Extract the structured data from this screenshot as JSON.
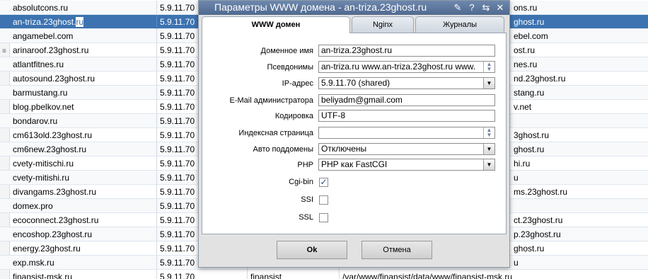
{
  "table": {
    "rows": [
      {
        "name": "absolutcons.ru",
        "ip": "5.9.11.70",
        "owner": "",
        "path": "",
        "right_visible": "ons.ru"
      },
      {
        "name": "an-triza.23ghost.ru",
        "ip": "5.9.11.70",
        "owner": "",
        "path": "",
        "right_visible": "ghost.ru"
      },
      {
        "name": "angamebel.com",
        "ip": "5.9.11.70",
        "owner": "",
        "path": "",
        "right_visible": "ebel.com"
      },
      {
        "name": "arinaroof.23ghost.ru",
        "ip": "5.9.11.70",
        "owner": "",
        "path": "",
        "right_visible": "ost.ru"
      },
      {
        "name": "atlantfitnes.ru",
        "ip": "5.9.11.70",
        "owner": "",
        "path": "",
        "right_visible": "nes.ru"
      },
      {
        "name": "autosound.23ghost.ru",
        "ip": "5.9.11.70",
        "owner": "",
        "path": "",
        "right_visible": "nd.23ghost.ru"
      },
      {
        "name": "barmustang.ru",
        "ip": "5.9.11.70",
        "owner": "",
        "path": "",
        "right_visible": "stang.ru"
      },
      {
        "name": "blog.pbelkov.net",
        "ip": "5.9.11.70",
        "owner": "",
        "path": "",
        "right_visible": "v.net"
      },
      {
        "name": "bondarov.ru",
        "ip": "5.9.11.70",
        "owner": "",
        "path": "",
        "right_visible": ""
      },
      {
        "name": "cm613old.23ghost.ru",
        "ip": "5.9.11.70",
        "owner": "",
        "path": "",
        "right_visible": "3ghost.ru"
      },
      {
        "name": "cm6new.23ghost.ru",
        "ip": "5.9.11.70",
        "owner": "",
        "path": "",
        "right_visible": "ghost.ru"
      },
      {
        "name": "cvety-mitischi.ru",
        "ip": "5.9.11.70",
        "owner": "",
        "path": "",
        "right_visible": "hi.ru"
      },
      {
        "name": "cvety-mitishi.ru",
        "ip": "5.9.11.70",
        "owner": "",
        "path": "",
        "right_visible": "u"
      },
      {
        "name": "divangams.23ghost.ru",
        "ip": "5.9.11.70",
        "owner": "",
        "path": "",
        "right_visible": "ms.23ghost.ru"
      },
      {
        "name": "domex.pro",
        "ip": "5.9.11.70",
        "owner": "",
        "path": "",
        "right_visible": ""
      },
      {
        "name": "ecoconnect.23ghost.ru",
        "ip": "5.9.11.70",
        "owner": "",
        "path": "",
        "right_visible": "ct.23ghost.ru"
      },
      {
        "name": "encoshop.23ghost.ru",
        "ip": "5.9.11.70",
        "owner": "",
        "path": "",
        "right_visible": "p.23ghost.ru"
      },
      {
        "name": "energy.23ghost.ru",
        "ip": "5.9.11.70",
        "owner": "",
        "path": "",
        "right_visible": "ghost.ru"
      },
      {
        "name": "exp.msk.ru",
        "ip": "5.9.11.70",
        "owner": "",
        "path": "",
        "right_visible": "u"
      },
      {
        "name": "finansist-msk.ru",
        "ip": "5.9.11.70",
        "owner": "finansist",
        "path": "/var/www/finansist/data/www/finansist-msk.ru",
        "right_visible": ""
      }
    ],
    "selected_row": 1,
    "selected_name_plain": "an-triza.23ghost.",
    "selected_name_highlight": "ru"
  },
  "modal": {
    "title": "Параметры WWW домена - an-triza.23ghost.ru",
    "icons": [
      "pin-icon",
      "help-icon",
      "restore-icon",
      "close-icon"
    ],
    "icon_glyphs": {
      "pin": "✎",
      "help": "?",
      "restore": "⇆",
      "close": "✕"
    },
    "tabs": [
      "WWW домен",
      "Nginx",
      "Журналы"
    ],
    "fields": {
      "domain_label": "Доменное имя",
      "domain_value": "an-triza.23ghost.ru",
      "aliases_label": "Псевдонимы",
      "aliases_value": "an-triza.ru www.an-triza.23ghost.ru www.",
      "ip_label": "IP-адрес",
      "ip_value": "5.9.11.70 (shared)",
      "email_label": "E-Mail администратора",
      "email_value": "beliyadm@gmail.com",
      "encoding_label": "Кодировка",
      "encoding_value": "UTF-8",
      "index_label": "Индексная страница",
      "index_value": "",
      "autosub_label": "Авто поддомены",
      "autosub_value": "Отключены",
      "php_label": "PHP",
      "php_value": "PHP как FastCGI",
      "cgi_label": "Cgi-bin",
      "cgi_checked": true,
      "ssi_label": "SSI",
      "ssi_checked": false,
      "ssl_label": "SSL",
      "ssl_checked": false
    },
    "buttons": {
      "ok": "Ok",
      "cancel": "Отмена"
    }
  },
  "colors": {
    "title_bar": "#5f7aa0",
    "selected_row": "#3c73b0",
    "panel_bg": "#e2e2e2"
  }
}
